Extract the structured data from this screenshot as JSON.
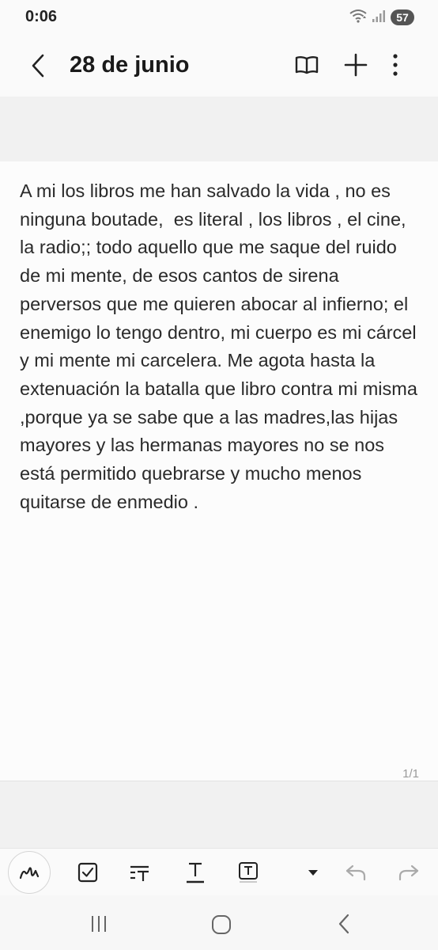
{
  "status_bar": {
    "time": "0:06",
    "battery": "57",
    "icons": [
      "wifi-icon",
      "signal-icon",
      "battery-icon"
    ]
  },
  "header": {
    "title": "28 de junio",
    "icons": [
      "back-icon",
      "book-icon",
      "plus-icon",
      "more-vertical-icon"
    ]
  },
  "note": {
    "text": "A mi los libros me han salvado la vida , no es ninguna boutade,  es literal , los libros , el cine, la radio;; todo aquello que me saque del ruido de mi mente, de esos cantos de sirena perversos que me quieren abocar al infierno; el enemigo lo tengo dentro, mi cuerpo es mi cárcel y mi mente mi carcelera. Me agota hasta la extenuación la batalla que libro contra mi misma ,porque ya se sabe que a las madres,las hijas mayores y las hermanas mayores no se nos está permitido quebrarse y mucho menos quitarse de enmedio .",
    "page_indicator": "1/1"
  },
  "toolbar": {
    "icons": [
      "pen-icon",
      "checkbox-icon",
      "text-format-icon",
      "underline-text-icon",
      "text-box-icon",
      "dropdown-arrow-icon",
      "undo-icon",
      "redo-icon"
    ]
  },
  "nav_bar": {
    "icons": [
      "recent-apps-icon",
      "home-icon",
      "back-nav-icon"
    ]
  }
}
